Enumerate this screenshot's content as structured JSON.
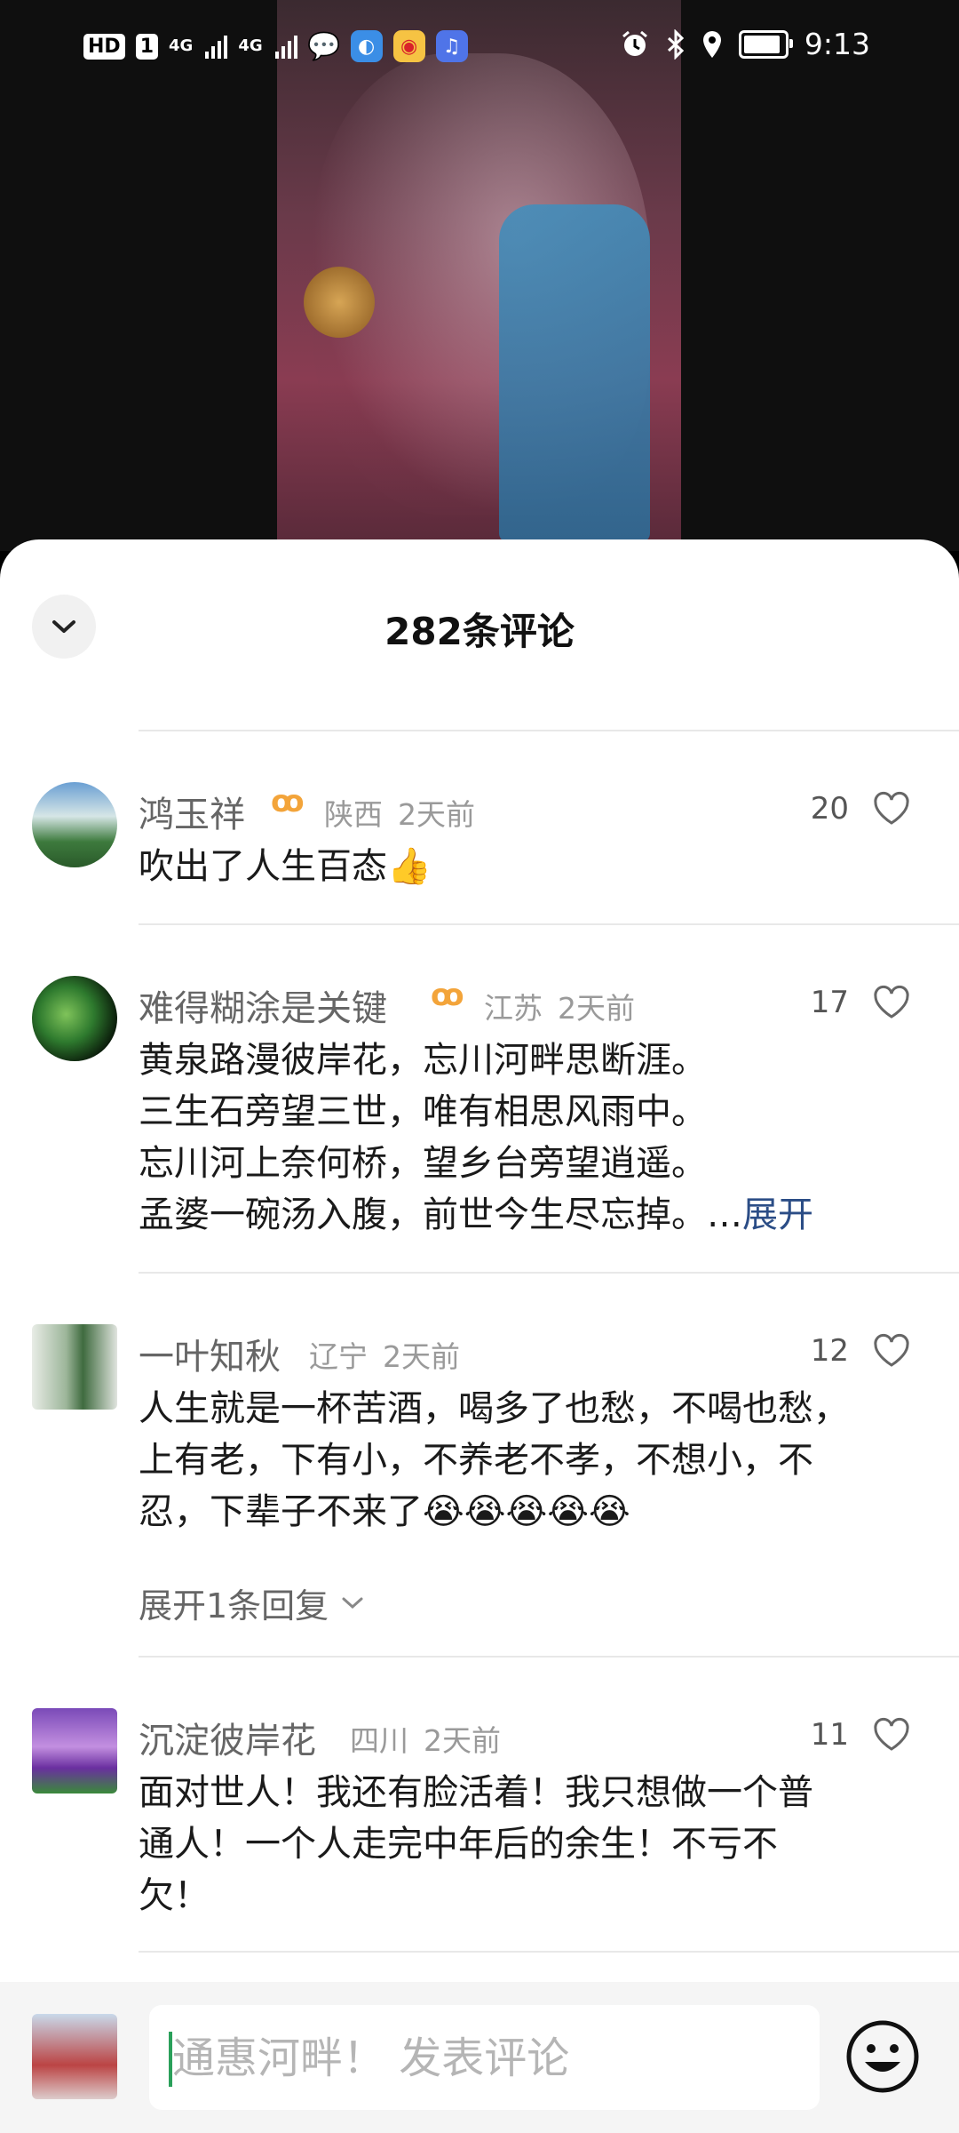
{
  "status_bar": {
    "hd_label": "HD",
    "sim_label": "1",
    "net1": "4G",
    "net2": "4G",
    "time": "9:13"
  },
  "sheet": {
    "title": "282条评论"
  },
  "comments": [
    {
      "name": "鸿玉祥",
      "location": "陕西",
      "time": "2天前",
      "likes": "20",
      "text": [
        "吹出了人生百态👍"
      ]
    },
    {
      "name": "难得糊涂是关键",
      "location": "江苏",
      "time": "2天前",
      "likes": "17",
      "text": [
        "黄泉路漫彼岸花，忘川河畔思断涯。",
        "三生石旁望三世，唯有相思风雨中。",
        "忘川河上奈何桥，望乡台旁望逍遥。",
        "孟婆一碗汤入腹，前世今生尽忘掉。…"
      ],
      "expand_label": "展开"
    },
    {
      "name": "一叶知秋",
      "location": "辽宁",
      "time": "2天前",
      "likes": "12",
      "text": [
        "人生就是一杯苦酒，喝多了也愁，不喝也愁，",
        "上有老，下有小，不养老不孝，不想小，不",
        "忍，下辈子不来了😭😭😭😭😭"
      ],
      "replies_label": "展开1条回复"
    },
    {
      "name": "沉淀彼岸花",
      "location": "四川",
      "time": "2天前",
      "likes": "11",
      "text": [
        "面对世人！我还有脸活着！我只想做一个普",
        "通人！一个人走完中年后的余生！不亏不",
        "欠！"
      ]
    }
  ],
  "input": {
    "placeholder": "通惠河畔！ 发表评论"
  }
}
